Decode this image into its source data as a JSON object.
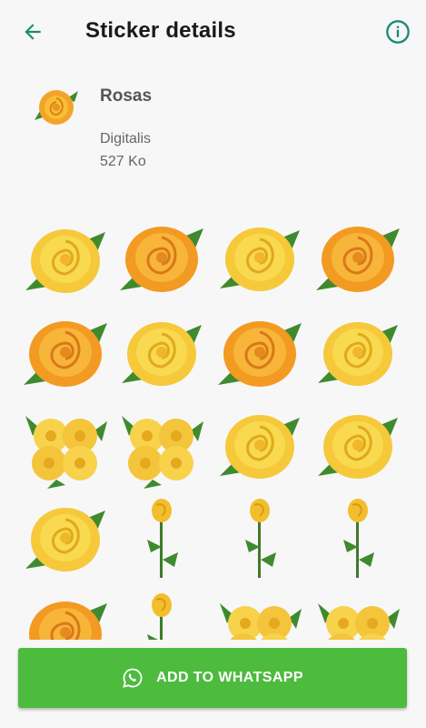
{
  "appbar": {
    "title": "Sticker details"
  },
  "pack": {
    "name": "Rosas",
    "publisher": "Digitalis",
    "size": "527 Ko"
  },
  "icons": {
    "back": "arrow-back-icon",
    "info": "info-icon",
    "whatsapp": "whatsapp-icon"
  },
  "colors": {
    "accent": "#1b8a73",
    "button": "#4dbb3e",
    "rose_yellow": "#f7c52a",
    "rose_orange": "#f3a428",
    "leaf": "#3f8a2e"
  },
  "stickers": [
    "yellow-rose",
    "orange-rose",
    "yellow-rose",
    "orange-rose",
    "orange-rose",
    "yellow-rose",
    "orange-rose",
    "yellow-rose",
    "rose-bouquet",
    "rose-bouquet",
    "yellow-rose",
    "yellow-rose",
    "yellow-rose",
    "rose-stem",
    "rose-stem",
    "rose-stem",
    "orange-rose",
    "rose-stem",
    "rose-bouquet",
    "rose-bouquet"
  ],
  "actions": {
    "add_to_whatsapp": "ADD TO WHATSAPP"
  }
}
